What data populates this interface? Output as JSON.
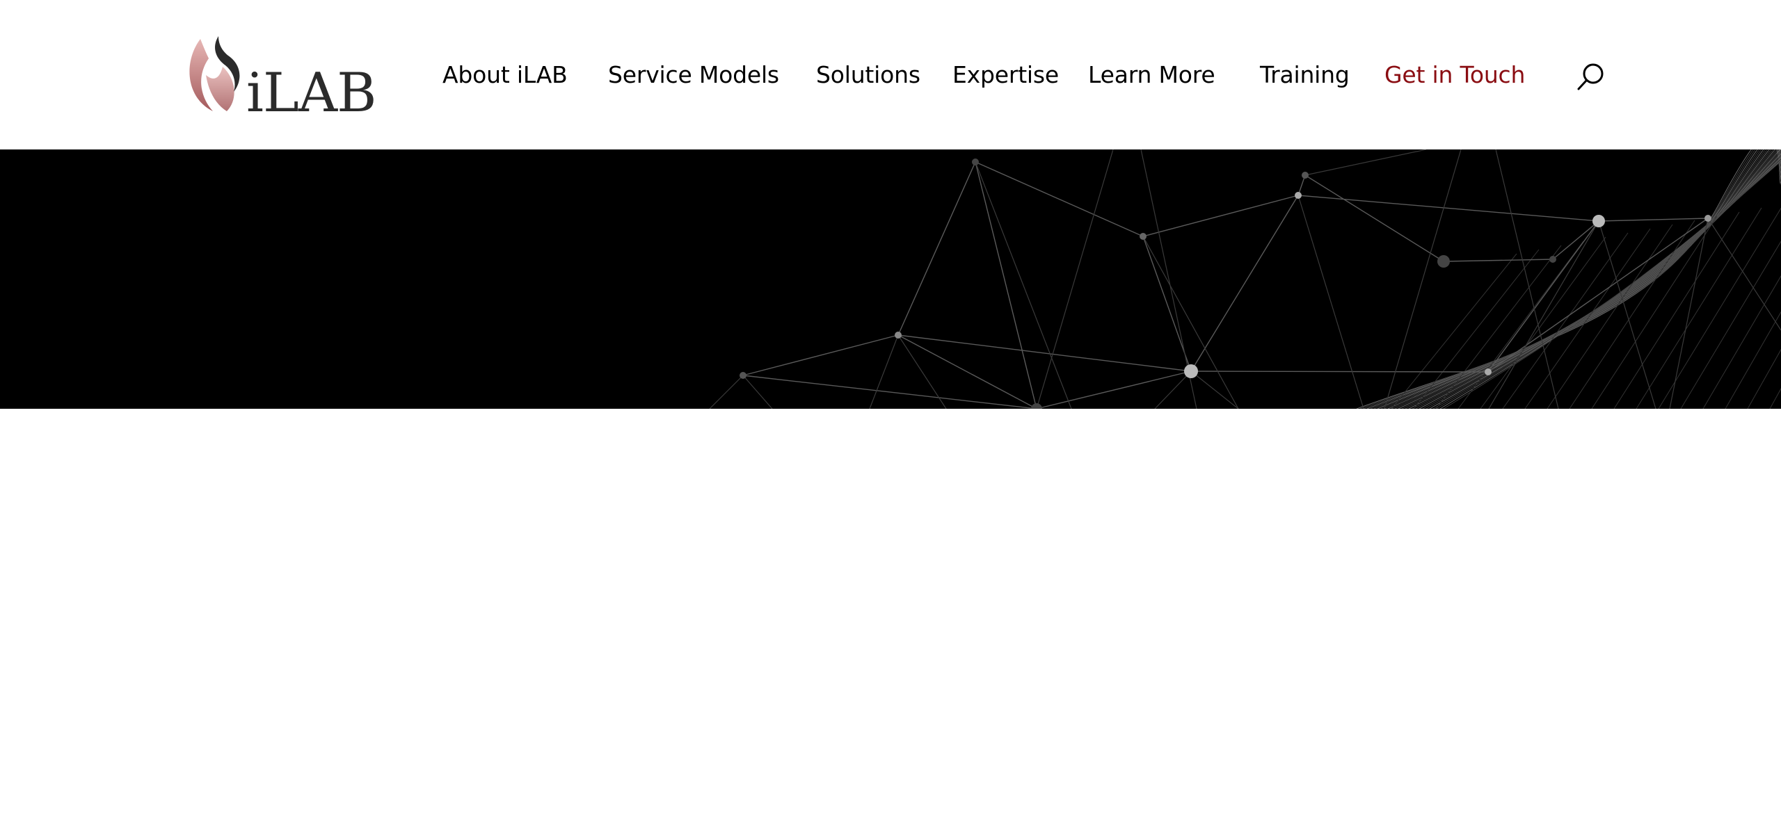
{
  "brand": {
    "logo_text": "iLAB",
    "logo_alt": "iLAB"
  },
  "nav": {
    "items": [
      {
        "label": "About iLAB"
      },
      {
        "label": "Service Models"
      },
      {
        "label": "Solutions"
      },
      {
        "label": "Expertise"
      },
      {
        "label": "Learn More"
      },
      {
        "label": "Training"
      },
      {
        "label": "Get in Touch"
      }
    ],
    "search_icon": "search-icon"
  },
  "colors": {
    "accent": "#8a0d12",
    "nav_text": "#000000",
    "hero_bg": "#000000",
    "logo_flame_pink": "#c98b8b",
    "logo_flame_dark": "#2b2b2b"
  },
  "hero": {
    "graphic": "network-mesh-graphic"
  }
}
